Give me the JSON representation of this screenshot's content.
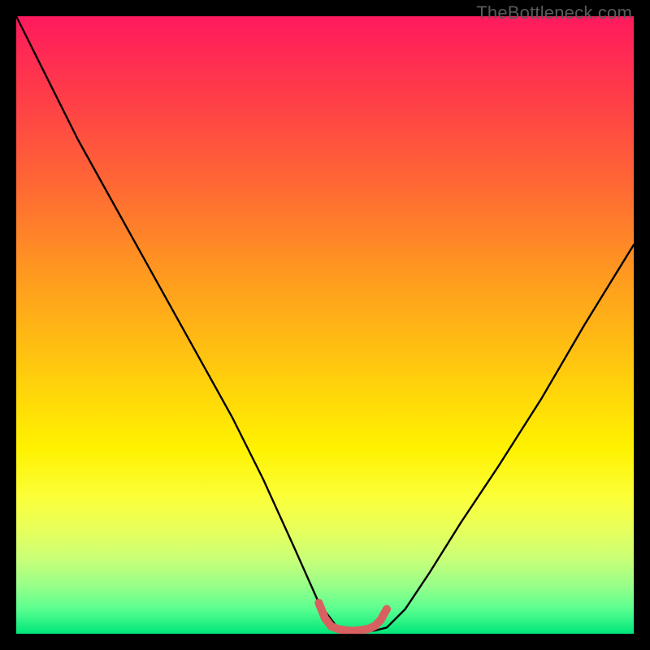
{
  "watermark": "TheBottleneck.com",
  "colors": {
    "background": "#000000",
    "curve": "#000000",
    "highlight": "#d96060"
  },
  "chart_data": {
    "type": "line",
    "title": "",
    "xlabel": "",
    "ylabel": "",
    "xlim": [
      0,
      100
    ],
    "ylim": [
      0,
      100
    ],
    "grid": false,
    "legend": false,
    "series": [
      {
        "name": "bottleneck_curve",
        "x": [
          0,
          5,
          10,
          15,
          20,
          25,
          30,
          35,
          40,
          45,
          49,
          52,
          55,
          58,
          60,
          63,
          67,
          72,
          78,
          85,
          92,
          100
        ],
        "y": [
          100,
          90,
          80,
          71,
          62,
          53,
          44,
          35,
          25,
          14,
          5,
          1,
          0.5,
          0.5,
          1,
          4,
          10,
          18,
          27,
          38,
          50,
          63
        ]
      },
      {
        "name": "optimal_range_highlight",
        "x": [
          49,
          50,
          51,
          52,
          53,
          54,
          55,
          56,
          57,
          58,
          59,
          60
        ],
        "y": [
          5,
          2.5,
          1.2,
          0.8,
          0.6,
          0.5,
          0.5,
          0.6,
          0.8,
          1.2,
          2.2,
          4
        ]
      }
    ]
  }
}
